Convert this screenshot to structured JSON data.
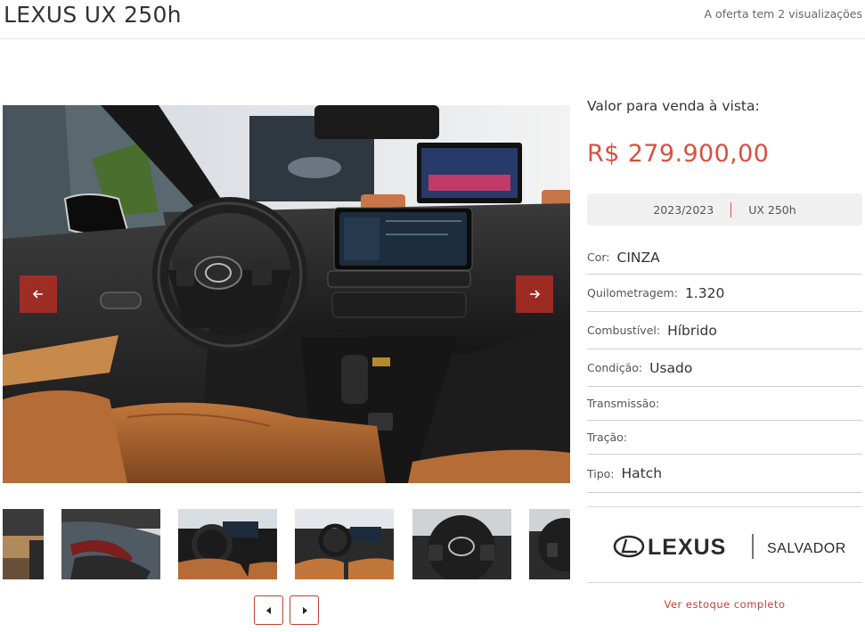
{
  "header": {
    "title": "LEXUS UX 250h",
    "views_text": "A oferta tem 2 visualizações"
  },
  "gallery": {
    "prev_icon": "arrow-left-icon",
    "next_icon": "arrow-right-icon",
    "thumbnails": [
      {
        "subject": "showroom-floor"
      },
      {
        "subject": "taillight-detail"
      },
      {
        "subject": "interior-dashboard"
      },
      {
        "subject": "interior-front-seats"
      },
      {
        "subject": "steering-wheel"
      },
      {
        "subject": "steering-wheel-partial"
      }
    ]
  },
  "pricing": {
    "label": "Valor para venda à vista:",
    "price": "R$ 279.900,00"
  },
  "version": {
    "year": "2023/2023",
    "model": "UX 250h"
  },
  "specs": [
    {
      "key": "Cor:",
      "value": "CINZA"
    },
    {
      "key": "Quilometragem:",
      "value": "1.320"
    },
    {
      "key": "Combustível:",
      "value": "Híbrido"
    },
    {
      "key": "Condição:",
      "value": "Usado"
    },
    {
      "key": "Transmissão:",
      "value": ""
    },
    {
      "key": "Tração:",
      "value": ""
    },
    {
      "key": "Tipo:",
      "value": "Hatch"
    }
  ],
  "dealer": {
    "brand": "LEXUS",
    "location": "SALVADOR"
  },
  "stock_link": "Ver estoque completo",
  "colors": {
    "accent": "#d9503c",
    "link": "#c4402f",
    "arrow_bg": "#be2d23",
    "divider": "#cfcfcf"
  }
}
